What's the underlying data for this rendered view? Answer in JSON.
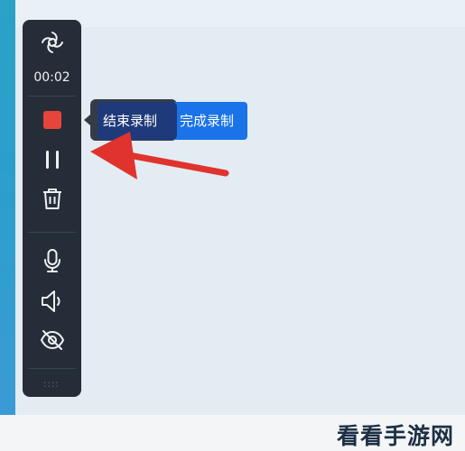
{
  "recorder": {
    "timer": "00:02",
    "icons": {
      "logo": "logo-icon",
      "stop": "stop-recording-icon",
      "pause": "pause-icon",
      "delete": "trash-icon",
      "mic": "microphone-icon",
      "speaker": "speaker-icon",
      "camera_off": "camera-off-icon",
      "grip": "drag-handle-icon"
    }
  },
  "tooltip": {
    "end_label": "结束录制",
    "finish_label": "完成录制"
  },
  "watermark": {
    "text": "看看手游网"
  },
  "colors": {
    "toolbar_bg": "#252d38",
    "stop_red": "#e8453a",
    "button_blue": "#1a73e8",
    "arrow_red": "#e0332e"
  }
}
